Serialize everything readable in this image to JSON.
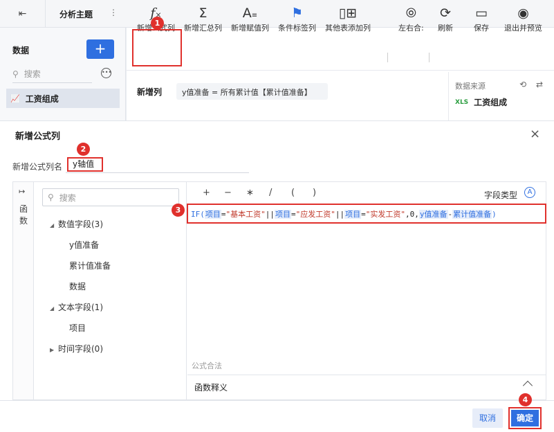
{
  "topbar": {
    "back_icon": "exit-left-icon",
    "title": "分析主题",
    "menu_icon": "vertical-dots-icon"
  },
  "left": {
    "title": "数据",
    "add_label": "+",
    "search_placeholder": "搜索",
    "more_icon": "ellipsis-circle-icon",
    "dataset": "工资组成",
    "dataset_icon": "line-chart-icon"
  },
  "toolbar": {
    "items": [
      {
        "label": "新增公式列",
        "icon": "fx-icon"
      },
      {
        "label": "新增汇总列",
        "icon": "sigma-icon"
      },
      {
        "label": "新增赋值列",
        "icon": "assign-icon"
      },
      {
        "label": "条件标签列",
        "icon": "flag-icon"
      },
      {
        "label": "其他表添加列",
        "icon": "add-column-icon"
      },
      {
        "label": "左右合:",
        "icon": "venn-icon"
      },
      {
        "label": "刷新",
        "icon": "refresh-icon"
      },
      {
        "label": "保存",
        "icon": "save-icon"
      },
      {
        "label": "退出并预览",
        "icon": "preview-icon"
      }
    ]
  },
  "editor": {
    "new_col_label": "新增列",
    "formula_preview": "y值准备 = 所有累计值【累计值准备】",
    "source_title": "数据来源",
    "source_item": "工资组成",
    "xls_label": "XLS"
  },
  "dialog": {
    "title": "新增公式列",
    "close": "×",
    "name_label": "新增公式列名",
    "name_value": "y轴值",
    "func_label": "函数",
    "field_search_placeholder": "搜索",
    "tree": [
      {
        "label": "数值字段(3)",
        "children": [
          "y值准备",
          "累计值准备",
          "数据"
        ]
      },
      {
        "label": "文本字段(1)",
        "children": [
          "项目"
        ]
      },
      {
        "label": "时间字段(0)",
        "children": []
      }
    ],
    "operators": [
      "+",
      "−",
      "∗",
      "/",
      "(",
      ")"
    ],
    "field_type_label": "字段类型",
    "field_type_icon": "A",
    "formula": {
      "if": "IF(",
      "f1": "项目",
      "eq1": "=",
      "s1": "\"基本工资\"",
      "or1": "||",
      "f2": "项目",
      "eq2": "=",
      "s2": "\"应发工资\"",
      "or2": "||",
      "f3": "项目",
      "eq3": "=",
      "s3": "\"实发工资\"",
      "zero": ",0,",
      "f4": "y值准备",
      "minus": "-",
      "f5": "累计值准备",
      "close": ")"
    },
    "legal_text": "公式合法",
    "explain_label": "函数释义",
    "cancel": "取消",
    "ok": "确定"
  },
  "badges": [
    "1",
    "2",
    "3",
    "4"
  ],
  "colors": {
    "accent": "#2f6fe0",
    "highlight": "#e0302c"
  }
}
